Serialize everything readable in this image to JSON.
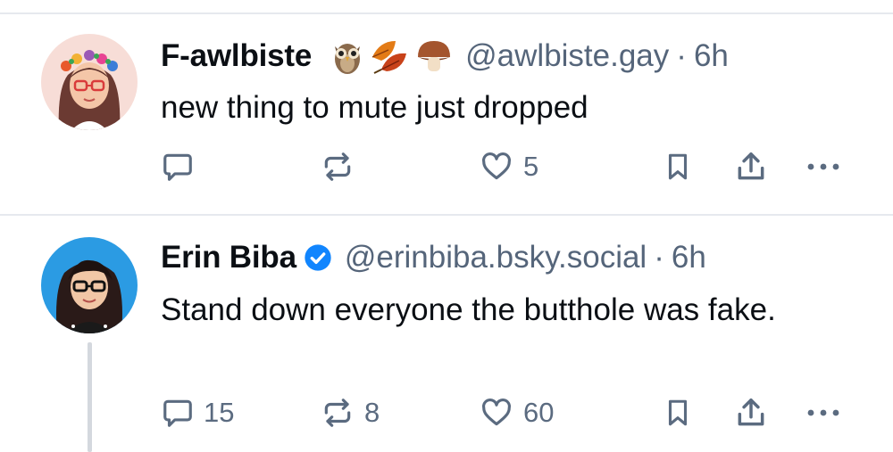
{
  "posts": [
    {
      "display_name": "F-awlbiste",
      "name_emojis": [
        "owl",
        "autumn-leaves",
        "mushroom"
      ],
      "handle": "@awlbiste.gay",
      "separator": "·",
      "time": "6h",
      "text": "new thing to mute just dropped",
      "counts": {
        "reply": "",
        "repost": "",
        "like": "5"
      }
    },
    {
      "display_name": "Erin Biba",
      "verified": true,
      "handle": "@erinbiba.bsky.social",
      "separator": "·",
      "time": "6h",
      "text": "Stand down everyone the butthole was fake.",
      "counts": {
        "reply": "15",
        "repost": "8",
        "like": "60"
      }
    }
  ],
  "colors": {
    "text": "#0b0f14",
    "muted": "#55657a",
    "icon": "#5b6b80",
    "verified": "#1185fe",
    "divider": "#e6e9ee",
    "thread_line": "#d4d8de"
  },
  "icons": [
    "reply-icon",
    "repost-icon",
    "like-icon",
    "bookmark-icon",
    "share-icon",
    "more-icon"
  ]
}
